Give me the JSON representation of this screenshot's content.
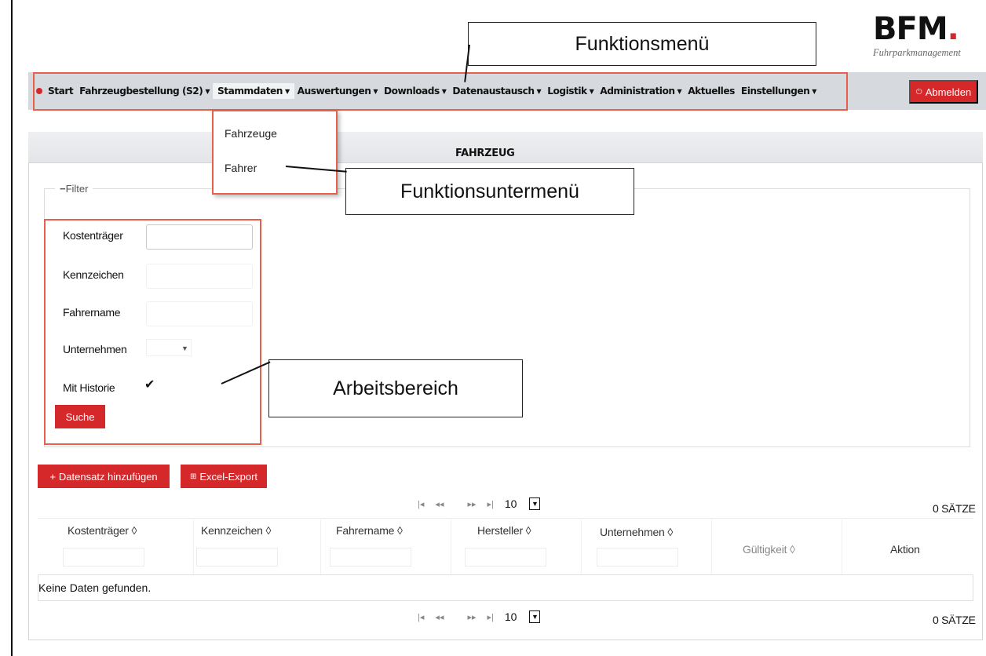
{
  "logo": {
    "mark": "BFM",
    "dot": ".",
    "subtitle": "Fuhrparkmanagement"
  },
  "nav": {
    "items": [
      {
        "label": "Start",
        "caret": ""
      },
      {
        "label": "Fahrzeugbestellung (S2)",
        "caret": "▼"
      },
      {
        "label": "Stammdaten",
        "caret": "▼"
      },
      {
        "label": "Auswertungen",
        "caret": "▼"
      },
      {
        "label": "Downloads",
        "caret": "▼"
      },
      {
        "label": "Datenaustausch",
        "caret": "▼"
      },
      {
        "label": "Logistik",
        "caret": "▼"
      },
      {
        "label": "Administration",
        "caret": "▼"
      },
      {
        "label": "Aktuelles",
        "caret": ""
      },
      {
        "label": "Einstellungen",
        "caret": "▼"
      }
    ],
    "active_item": "Stammdaten",
    "logout_label": "Abmelden"
  },
  "dropdown": {
    "items": [
      "Fahrzeuge",
      "Fahrer"
    ]
  },
  "annotations": {
    "menu": "Funktionsmenü",
    "submenu": "Funktionsuntermenü",
    "workspace": "Arbeitsbereich"
  },
  "panel": {
    "title": "FAHRZEUG"
  },
  "filter": {
    "legend": "Filter",
    "legend_icon": "minus-icon",
    "fields": {
      "kostentraeger": "Kostenträger",
      "kennzeichen": "Kennzeichen",
      "fahrername": "Fahrername",
      "unternehmen": "Unternehmen",
      "mit_historie": "Mit Historie"
    },
    "unternehmen_caret": "▼",
    "mit_historie_checked": "✔",
    "search_label": "Suche"
  },
  "actions": {
    "add_label": "Datensatz hinzufügen",
    "export_label": "Excel-Export"
  },
  "table": {
    "columns": [
      "Kostenträger ◊",
      "Kennzeichen ◊",
      "Fahrername ◊",
      "Hersteller ◊",
      "Unternehmen ◊",
      "Gültigkeit ◊",
      "Aktion"
    ],
    "empty_message": "Keine Daten gefunden.",
    "page_size": "10",
    "record_count": "0 SÄTZE",
    "pager_icons": {
      "first": "|◂",
      "prev": "◂◂",
      "next": "▸▸",
      "last": "▸|"
    }
  },
  "colors": {
    "accent": "#d4282b",
    "annotation_frame": "#e8604c",
    "navbar": "#d6d9de"
  }
}
